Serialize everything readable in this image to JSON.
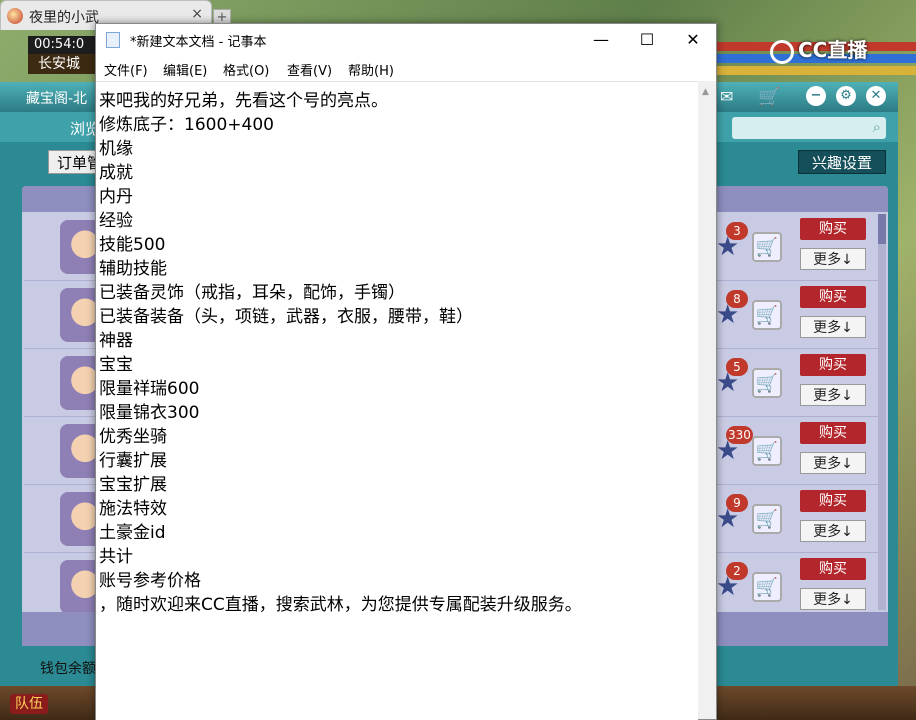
{
  "browser": {
    "tab_title": "夜里的小武",
    "close": "×",
    "new_tab": "+"
  },
  "hud": {
    "time": "00:54:0",
    "location": "长安城"
  },
  "cc_logo": {
    "text": "CC直播"
  },
  "treasure": {
    "title": "藏宝阁-北",
    "nav_label": "浏览",
    "order_label": "订单管",
    "interest_button": "兴趣设置",
    "wallet_label": "钱包余额",
    "rows": [
      {
        "badge": "3",
        "buy": "购买",
        "more": "更多↓"
      },
      {
        "badge": "8",
        "buy": "购买",
        "more": "更多↓"
      },
      {
        "badge": "5",
        "buy": "购买",
        "more": "更多↓"
      },
      {
        "badge": "330",
        "buy": "购买",
        "more": "更多↓"
      },
      {
        "badge": "9",
        "buy": "购买",
        "more": "更多↓"
      },
      {
        "badge": "2",
        "buy": "购买",
        "more": "更多↓"
      }
    ]
  },
  "bottom_bar": {
    "team_button": "队伍"
  },
  "notepad": {
    "title": "*新建文本文档 - 记事本",
    "controls": {
      "minimize": "—",
      "maximize": "☐",
      "close": "✕"
    },
    "menu": [
      "文件(F)",
      "编辑(E)",
      "格式(O)",
      "查看(V)",
      "帮助(H)"
    ],
    "lines": [
      "来吧我的好兄弟，先看这个号的亮点。",
      "修炼底子：1600+400",
      "机缘",
      "成就",
      "内丹",
      "经验",
      "技能500",
      "辅助技能",
      "已装备灵饰（戒指，耳朵，配饰，手镯）",
      "已装备装备（头，项链，武器，衣服，腰带，鞋）",
      "神器",
      "宝宝",
      "限量祥瑞600",
      "限量锦衣300",
      "优秀坐骑",
      "行囊扩展",
      "宝宝扩展",
      "施法特效",
      "土豪金id",
      "共计",
      "账号参考价格",
      "，随时欢迎来CC直播，搜索武林，为您提供专属配装升级服务。"
    ]
  },
  "colors": {
    "buy_red": "#b3262c",
    "teal": "#2b8a93",
    "panel_lavender": "#c9cbe4"
  }
}
